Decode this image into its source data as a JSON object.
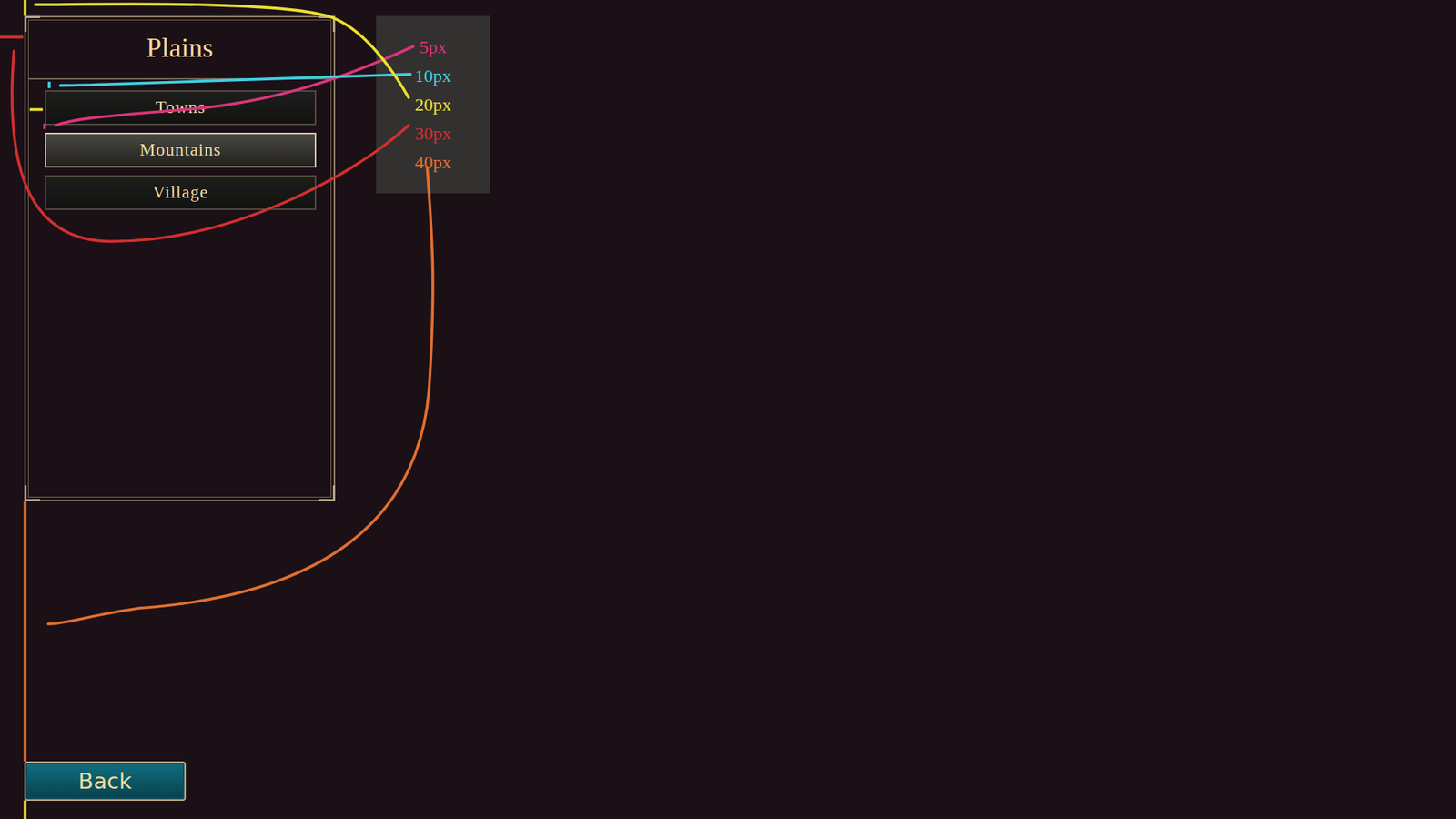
{
  "panel": {
    "title": "Plains",
    "items": [
      {
        "label": "Towns",
        "selected": false
      },
      {
        "label": "Mountains",
        "selected": true
      },
      {
        "label": "Village",
        "selected": false
      }
    ]
  },
  "back_button": {
    "label": "Back"
  },
  "legend": [
    {
      "label": "5px",
      "color": "#d9357a"
    },
    {
      "label": "10px",
      "color": "#3fd0e0"
    },
    {
      "label": "20px",
      "color": "#e8e030"
    },
    {
      "label": "30px",
      "color": "#d03030"
    },
    {
      "label": "40px",
      "color": "#e07030"
    }
  ]
}
